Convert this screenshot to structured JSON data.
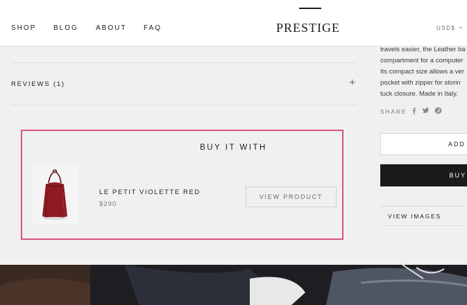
{
  "header": {
    "nav": [
      "SHOP",
      "BLOG",
      "ABOUT",
      "FAQ"
    ],
    "logo": "PRESTIGE",
    "currency": "USD$"
  },
  "reviews": {
    "label": "REVIEWS (1)"
  },
  "buy_with": {
    "title": "BUY IT WITH",
    "product_name": "LE PETIT VIOLETTE RED",
    "product_price": "$290",
    "view_button": "VIEW PRODUCT"
  },
  "side": {
    "description_lines": [
      "travels easier, the Leather ba",
      "compartment for a computer",
      "Its compact size allows a ver",
      "pocket with zipper for storin",
      "tuck closure. Made in Italy."
    ],
    "share_label": "SHARE",
    "share_icons": [
      "facebook-icon",
      "twitter-icon",
      "pinterest-icon"
    ],
    "add_button": "ADD",
    "buy_button": "BUY",
    "view_images": "VIEW IMAGES"
  },
  "colors": {
    "highlight": "#d9547a",
    "dark": "#1c1b1b",
    "bag": "#8e1a22"
  }
}
